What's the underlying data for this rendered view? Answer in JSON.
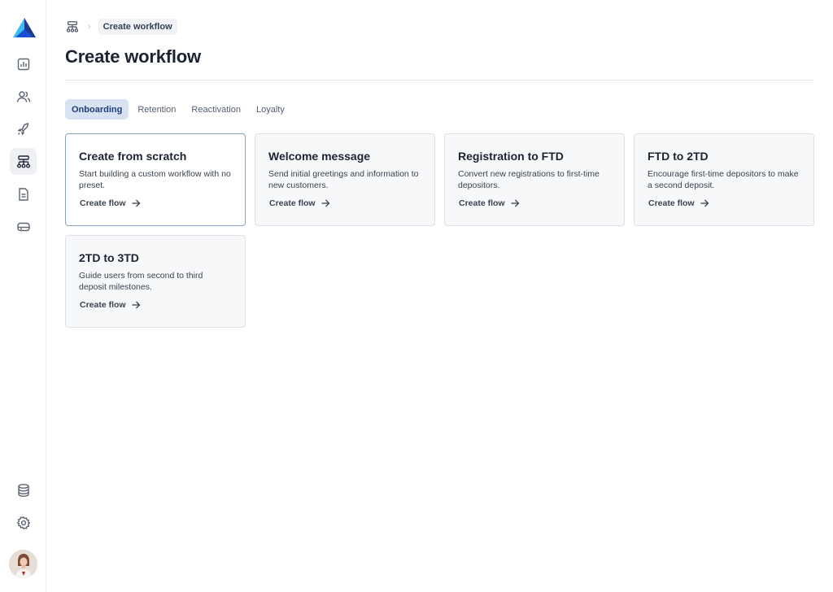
{
  "breadcrumb": {
    "home_icon": "workflow-icon",
    "separator": "›",
    "current": "Create workflow"
  },
  "page": {
    "title": "Create workflow"
  },
  "tabs": [
    {
      "label": "Onboarding",
      "active": true
    },
    {
      "label": "Retention",
      "active": false
    },
    {
      "label": "Reactivation",
      "active": false
    },
    {
      "label": "Loyalty",
      "active": false
    }
  ],
  "cards": [
    {
      "title": "Create from scratch",
      "description": "Start building a custom workflow with no preset.",
      "link": "Create flow",
      "selected": true
    },
    {
      "title": "Welcome message",
      "description": "Send initial greetings and information to new customers.",
      "link": "Create flow",
      "selected": false
    },
    {
      "title": "Registration to FTD",
      "description": "Convert new registrations to first-time depositors.",
      "link": "Create flow",
      "selected": false
    },
    {
      "title": "FTD to 2TD",
      "description": "Encourage first-time depositors to make a second deposit.",
      "link": "Create flow",
      "selected": false
    },
    {
      "title": "2TD to 3TD",
      "description": "Guide users from second to third deposit milestones.",
      "link": "Create flow",
      "selected": false
    }
  ],
  "sidebar": {
    "icons": [
      "chart-icon",
      "users-icon",
      "rocket-icon",
      "workflow-icon",
      "document-icon",
      "inbox-icon"
    ],
    "bottom_icons": [
      "database-icon",
      "gear-icon"
    ],
    "active": "workflow-icon"
  },
  "colors": {
    "accent": "#1f3f73",
    "tab_active_bg": "#d7e2f3",
    "logo_dark": "#1e3a8a",
    "logo_light": "#38bdf8"
  }
}
